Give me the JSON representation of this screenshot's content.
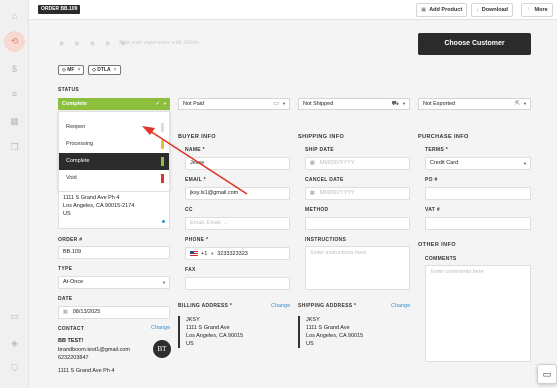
{
  "sidebar": {
    "icons": [
      "home-icon",
      "swirl-icon",
      "dollar-icon",
      "database-icon",
      "calendar-icon",
      "copy-icon",
      "chat-bubble-icon",
      "layers-icon",
      "shield-icon"
    ]
  },
  "topbar": {
    "order_tag": "ORDER BB.109",
    "add_product": "Add Product",
    "download": "Download",
    "more": "More"
  },
  "rating": {
    "stars": "★ ★ ★ ★ ★",
    "prompt": "Rate your experience with Jillian."
  },
  "choose_customer": "Choose Customer",
  "tags": [
    {
      "label": "MF",
      "close": "×"
    },
    {
      "label": "DTLA",
      "close": "×"
    }
  ],
  "status": {
    "label": "STATUS",
    "selected": "Complete",
    "options": [
      {
        "label": "Reopen",
        "color": "#dddddd"
      },
      {
        "label": "Processing",
        "color": "#e8c22f"
      },
      {
        "label": "Complete",
        "color": "#8bbf3c"
      },
      {
        "label": "Void",
        "color": "#d9342b"
      }
    ]
  },
  "payment_status": "Not Paid",
  "shipping_status": "Not Shipped",
  "export_status": "Not Exported",
  "address_block": {
    "lines": [
      "1111 S Grand Ave Ph 4",
      "Los Angeles, CA 90015-2174",
      "US"
    ]
  },
  "order_number": {
    "label": "ORDER #",
    "value": "BB.109"
  },
  "type": {
    "label": "TYPE",
    "value": "At-Once"
  },
  "date": {
    "label": "DATE",
    "value": "08/13/2025"
  },
  "contact": {
    "label": "CONTACT",
    "change": "Change",
    "name": "BB TEST!",
    "email": "brandboom.test1@gmail.com",
    "phone": "6232203847",
    "avatar": "BT"
  },
  "buyer_info": {
    "title": "BUYER INFO",
    "name_label": "NAME *",
    "name_value": "Jesse",
    "email_label": "EMAIL *",
    "email_value": "jksy.ls1@gmail.com",
    "cc_label": "CC",
    "cc_placeholder": "Email, Email, ...",
    "phone_label": "PHONE *",
    "phone_code": "+1",
    "phone_value": "3233323323",
    "fax_label": "FAX"
  },
  "shipping_info": {
    "title": "SHIPPING INFO",
    "ship_date_label": "SHIP DATE",
    "ship_date_placeholder": "MM/DD/YYYY",
    "cancel_date_label": "CANCEL DATE",
    "cancel_date_placeholder": "MM/DD/YYYY",
    "method_label": "METHOD",
    "instructions_label": "INSTRUCTIONS",
    "instructions_placeholder": "Enter instructions here"
  },
  "purchase_info": {
    "title": "PURCHASE INFO",
    "terms_label": "TERMS *",
    "terms_value": "Credit Card",
    "po_label": "PO #",
    "vat_label": "VAT #"
  },
  "other_info": {
    "title": "OTHER INFO",
    "comments_label": "COMMENTS",
    "comments_placeholder": "Enter comments here"
  },
  "billing_address": {
    "label": "BILLING ADDRESS *",
    "change": "Change",
    "lines": [
      "JKSY",
      "1111 S Grand Ave",
      "Los Angeles, CA 90015",
      "US"
    ]
  },
  "shipping_address": {
    "label": "SHIPPING ADDRESS *",
    "change": "Change",
    "lines": [
      "JKSY",
      "1111 S Grand Ave",
      "Los Angeles, CA 90015",
      "US"
    ]
  },
  "bottom_partial": "1111 S Grand Ave Ph 4",
  "annotation": {
    "color": "#e0352b"
  }
}
